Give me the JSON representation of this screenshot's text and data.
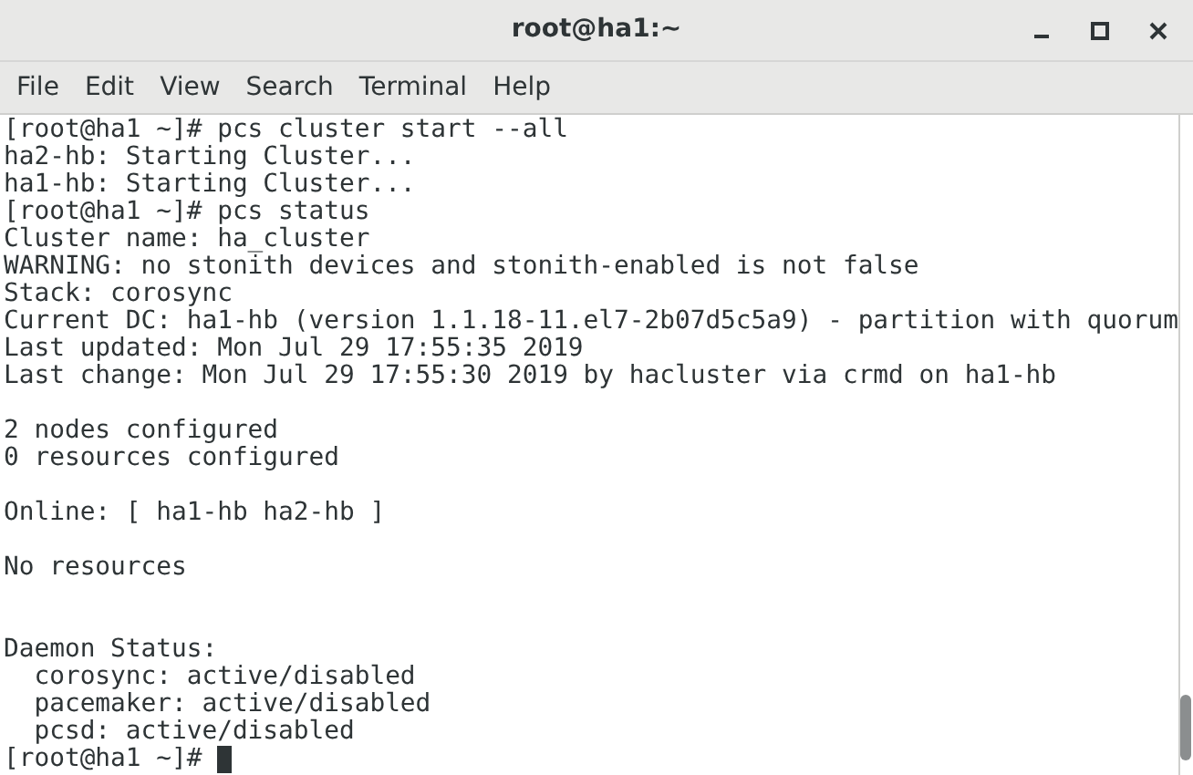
{
  "window": {
    "title": "root@ha1:~"
  },
  "menu": [
    "File",
    "Edit",
    "View",
    "Search",
    "Terminal",
    "Help"
  ],
  "terminal": {
    "lines": [
      {
        "kind": "text",
        "text": "[root@ha1 ~]# pcs cluster start --all"
      },
      {
        "kind": "text",
        "text": "ha2-hb: Starting Cluster..."
      },
      {
        "kind": "text",
        "text": "ha1-hb: Starting Cluster..."
      },
      {
        "kind": "text",
        "text": "[root@ha1 ~]# pcs status"
      },
      {
        "kind": "text",
        "text": "Cluster name: ha_cluster"
      },
      {
        "kind": "text",
        "text": "WARNING: no stonith devices and stonith-enabled is not false"
      },
      {
        "kind": "text",
        "text": "Stack: corosync"
      },
      {
        "kind": "text",
        "text": "Current DC: ha1-hb (version 1.1.18-11.el7-2b07d5c5a9) - partition with quorum"
      },
      {
        "kind": "text",
        "text": "Last updated: Mon Jul 29 17:55:35 2019"
      },
      {
        "kind": "text",
        "text": "Last change: Mon Jul 29 17:55:30 2019 by hacluster via crmd on ha1-hb"
      },
      {
        "kind": "blank"
      },
      {
        "kind": "text",
        "text": "2 nodes configured"
      },
      {
        "kind": "text",
        "text": "0 resources configured"
      },
      {
        "kind": "blank"
      },
      {
        "kind": "text",
        "text": "Online: [ ha1-hb ha2-hb ]"
      },
      {
        "kind": "blank"
      },
      {
        "kind": "text",
        "text": "No resources"
      },
      {
        "kind": "blank"
      },
      {
        "kind": "blank"
      },
      {
        "kind": "text",
        "text": "Daemon Status:"
      },
      {
        "kind": "text",
        "text": "  corosync: active/disabled"
      },
      {
        "kind": "text",
        "text": "  pacemaker: active/disabled"
      },
      {
        "kind": "text",
        "text": "  pcsd: active/disabled"
      },
      {
        "kind": "prompt",
        "text": "[root@ha1 ~]#"
      }
    ]
  }
}
